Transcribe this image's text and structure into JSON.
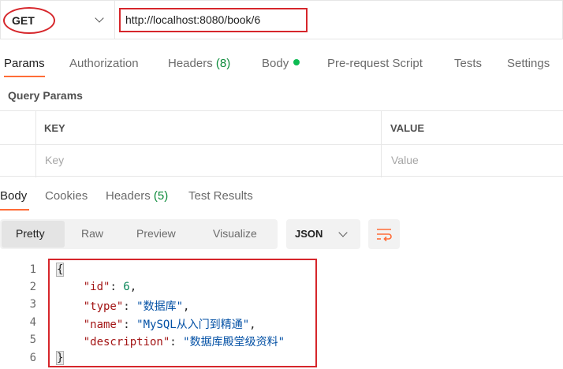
{
  "request": {
    "method": "GET",
    "url": "http://localhost:8080/book/6"
  },
  "request_tabs": {
    "params": "Params",
    "authorization": "Authorization",
    "headers": "Headers",
    "headers_count": "(8)",
    "body": "Body",
    "pre_request_script": "Pre-request Script",
    "tests": "Tests",
    "settings": "Settings"
  },
  "query_params": {
    "title": "Query Params",
    "key_header": "KEY",
    "value_header": "VALUE",
    "key_placeholder": "Key",
    "value_placeholder": "Value"
  },
  "response_tabs": {
    "body": "Body",
    "cookies": "Cookies",
    "headers": "Headers",
    "headers_count": "(5)",
    "test_results": "Test Results"
  },
  "response_toolbar": {
    "views": [
      "Pretty",
      "Raw",
      "Preview",
      "Visualize"
    ],
    "format": "JSON"
  },
  "response_body": {
    "line_numbers": [
      "1",
      "2",
      "3",
      "4",
      "5",
      "6"
    ],
    "open_brace": "{",
    "close_brace": "}",
    "fields": [
      {
        "key": "\"id\"",
        "value": "6",
        "type": "number",
        "comma": ","
      },
      {
        "key": "\"type\"",
        "value": "\"数据库\"",
        "type": "string",
        "comma": ","
      },
      {
        "key": "\"name\"",
        "value": "\"MySQL从入门到精通\"",
        "type": "string",
        "comma": ","
      },
      {
        "key": "\"description\"",
        "value": "\"数据库殿堂级资料\"",
        "type": "string",
        "comma": ""
      }
    ]
  },
  "colors": {
    "accent": "#ff6c37",
    "annotation": "#d6262b",
    "status_green": "#0cbb52"
  },
  "icons": {
    "method_dropdown": "chevron-down-icon",
    "format_dropdown": "chevron-down-icon",
    "wrap": "wrap-lines-icon"
  }
}
